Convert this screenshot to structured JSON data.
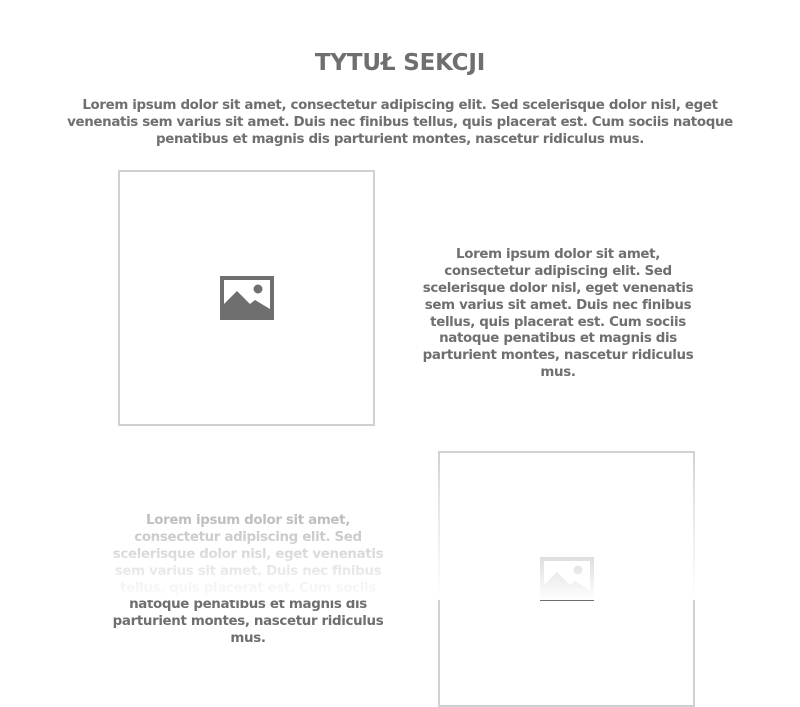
{
  "section": {
    "title": "TYTUŁ SEKCJI",
    "intro": "Lorem ipsum dolor sit amet, consectetur adipiscing elit. Sed scelerisque dolor nisl, eget venenatis sem varius sit amet. Duis nec finibus tellus, quis placerat est. Cum sociis natoque penatibus et magnis dis parturient montes, nascetur ridiculus mus."
  },
  "features": [
    {
      "image_icon": "image-placeholder-icon",
      "text": "Lorem ipsum dolor sit amet, consectetur adipiscing elit. Sed scelerisque dolor nisl, eget venenatis sem varius sit amet. Duis nec finibus tellus, quis placerat est. Cum sociis natoque penatibus et magnis dis parturient montes, nascetur ridiculus mus."
    },
    {
      "image_icon": "image-placeholder-icon",
      "text": "Lorem ipsum dolor sit amet, consectetur adipiscing elit. Sed scelerisque dolor nisl, eget venenatis sem varius sit amet. Duis nec finibus tellus, quis placerat est. Cum sociis natoque penatibus et magnis dis parturient montes, nascetur ridiculus mus."
    }
  ],
  "colors": {
    "text": "#6f6f6f",
    "border": "#d0d0d0",
    "icon": "#6f6f6f",
    "background": "#ffffff"
  }
}
